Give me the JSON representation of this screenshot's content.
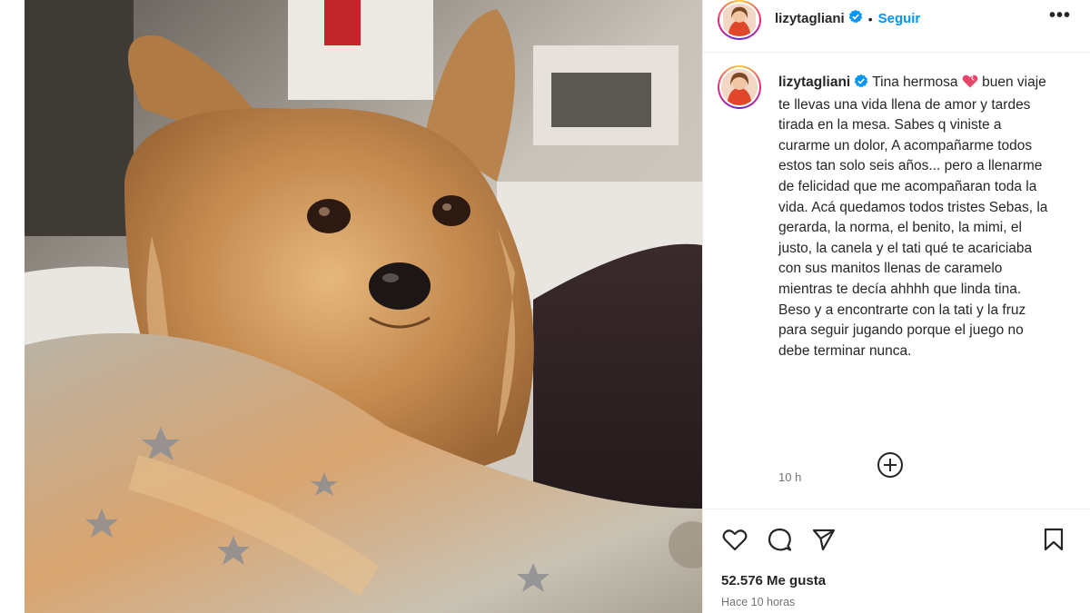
{
  "post": {
    "username": "lizytagliani",
    "separator": "•",
    "follow_label": "Seguir",
    "more_label": "•••",
    "caption_before_emoji": "Tina hermosa",
    "caption_emoji": "heart-emoji",
    "caption_after_emoji": "buen viaje te llevas una vida llena de amor y tardes tirada en la mesa. Sabes q viniste a curarme un dolor, A acompañarme todos estos tan solo seis años... pero a llenarme de felicidad que me acompañaran toda la vida. Acá quedamos todos tristes Sebas, la gerarda, la norma, el benito, la mimi, el justo, la canela y el tati qué te acariciaba con sus manitos llenas de caramelo mientras te decía ahhhh que linda tina. Beso y a encontrarte con la tati y la fruz para seguir jugando porque el juego no debe terminar nunca.",
    "caption_time": "10 h",
    "likes": "52.576 Me gusta",
    "posted_ago": "Hace 10 horas"
  },
  "icons": {
    "verified": "verified-badge-icon",
    "add_comment": "add-comment-icon",
    "like": "heart-icon",
    "comment": "comment-icon",
    "share": "send-icon",
    "save": "bookmark-icon"
  },
  "colors": {
    "accent": "#0095f6",
    "text": "#262626",
    "muted": "#737373",
    "verified": "#0095f6",
    "heart_emoji": "#e8456a"
  }
}
